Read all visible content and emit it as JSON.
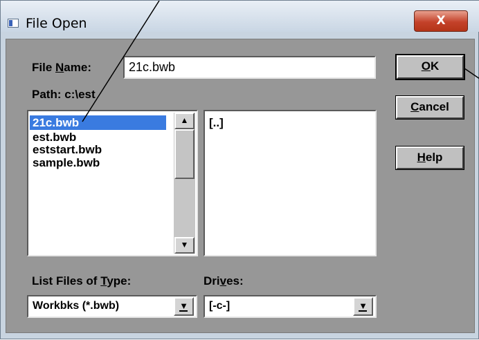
{
  "window": {
    "title": "File Open",
    "close_label": "X"
  },
  "dialog": {
    "file_name_label_pre": "File ",
    "file_name_label_key": "N",
    "file_name_label_post": "ame:",
    "file_name_value": "21c.bwb",
    "path_label": "Path:",
    "path_value": "c:\\est",
    "files": [
      {
        "name": "21c.bwb",
        "selected": true
      },
      {
        "name": "est.bwb",
        "selected": false
      },
      {
        "name": "eststart.bwb",
        "selected": false
      },
      {
        "name": "sample.bwb",
        "selected": false
      }
    ],
    "directories": [
      "[..]"
    ],
    "buttons": {
      "ok_key": "O",
      "ok_rest": "K",
      "cancel_key": "C",
      "cancel_rest": "ancel",
      "help_key": "H",
      "help_rest": "elp"
    },
    "type_label_pre": "List Files of ",
    "type_label_key": "T",
    "type_label_post": "ype:",
    "type_value": "Workbks (*.bwb)",
    "drives_label_pre": "Dri",
    "drives_label_key": "v",
    "drives_label_post": "es:",
    "drives_value": "[-c-]"
  },
  "icons": {
    "scroll_up": "up-arrow-icon",
    "scroll_down": "down-arrow-icon",
    "dropdown": "dropdown-arrow-icon"
  }
}
